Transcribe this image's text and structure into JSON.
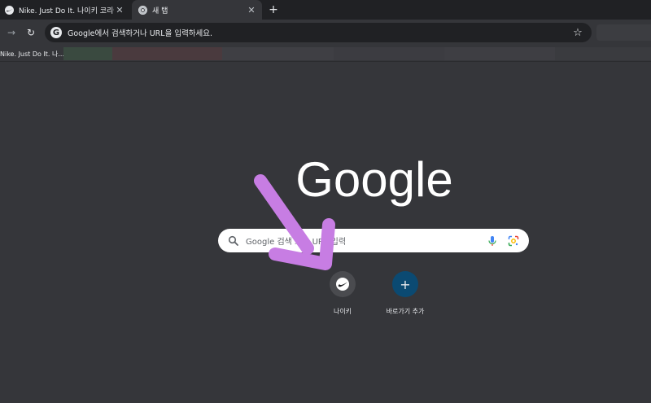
{
  "tabs": [
    {
      "title": "Nike. Just Do It. 나이키 코리아",
      "favicon": "nike-swoosh-icon",
      "active": false
    },
    {
      "title": "새 탭",
      "favicon": "chrome-icon",
      "active": true
    }
  ],
  "tab_close_symbol": "✕",
  "new_tab_symbol": "+",
  "toolbar": {
    "back_symbol": "→",
    "reload_symbol": "↻",
    "omnibox_badge": "G",
    "omnibox_text": "Google에서 검색하거나 URL을 입력하세요.",
    "star_symbol": "☆"
  },
  "bookmarks": [
    {
      "label": "Nike. Just Do It. 나..."
    }
  ],
  "ntp": {
    "logo_text": "Google",
    "search_placeholder": "Google 검색 또는 URL 입력",
    "shortcuts": [
      {
        "label": "나이키",
        "icon": "nike-swoosh-icon"
      },
      {
        "label": "바로가기 추가",
        "icon": "plus-icon",
        "symbol": "+"
      }
    ]
  },
  "colors": {
    "background": "#35363a",
    "tabstrip": "#202124",
    "add_shortcut": "#0b4a72",
    "annotation_arrow": "#c77de3"
  }
}
